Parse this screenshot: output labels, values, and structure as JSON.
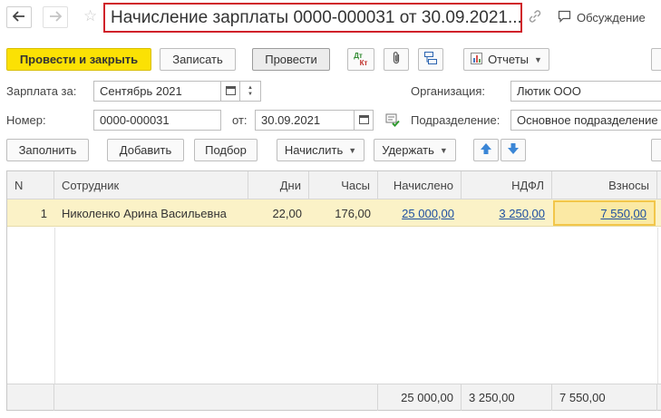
{
  "title": "Начисление зарплаты 0000-000031 от 30.09.2021...",
  "header": {
    "discussion_label": "Обсуждение"
  },
  "toolbar": {
    "post_and_close": "Провести и закрыть",
    "write": "Записать",
    "post": "Провести",
    "dtkt_top": "Дт",
    "dtkt_bottom": "Кт",
    "reports": "Отчеты"
  },
  "form": {
    "salary_for_label": "Зарплата за:",
    "salary_for_value": "Сентябрь 2021",
    "org_label": "Организация:",
    "org_value": "Лютик ООО",
    "number_label": "Номер:",
    "number_value": "0000-000031",
    "date_label": "от:",
    "date_value": "30.09.2021",
    "dept_label": "Подразделение:",
    "dept_value": "Основное подразделение"
  },
  "actions": {
    "fill": "Заполнить",
    "add": "Добавить",
    "select": "Подбор",
    "accrue": "Начислить",
    "withhold": "Удержать"
  },
  "table": {
    "columns": [
      "N",
      "Сотрудник",
      "Дни",
      "Часы",
      "Начислено",
      "НДФЛ",
      "Взносы"
    ],
    "rows": [
      {
        "n": "1",
        "employee": "Николенко Арина Васильевна",
        "days": "22,00",
        "hours": "176,00",
        "accrued": "25 000,00",
        "ndfl": "3 250,00",
        "contributions": "7 550,00"
      }
    ],
    "totals": {
      "accrued": "25 000,00",
      "ndfl": "3 250,00",
      "contributions": "7 550,00"
    }
  },
  "colors": {
    "primary": "#fbe104",
    "selected_row": "#fbf2c7",
    "title_border": "#d0222a",
    "link": "#1d4fa0"
  }
}
